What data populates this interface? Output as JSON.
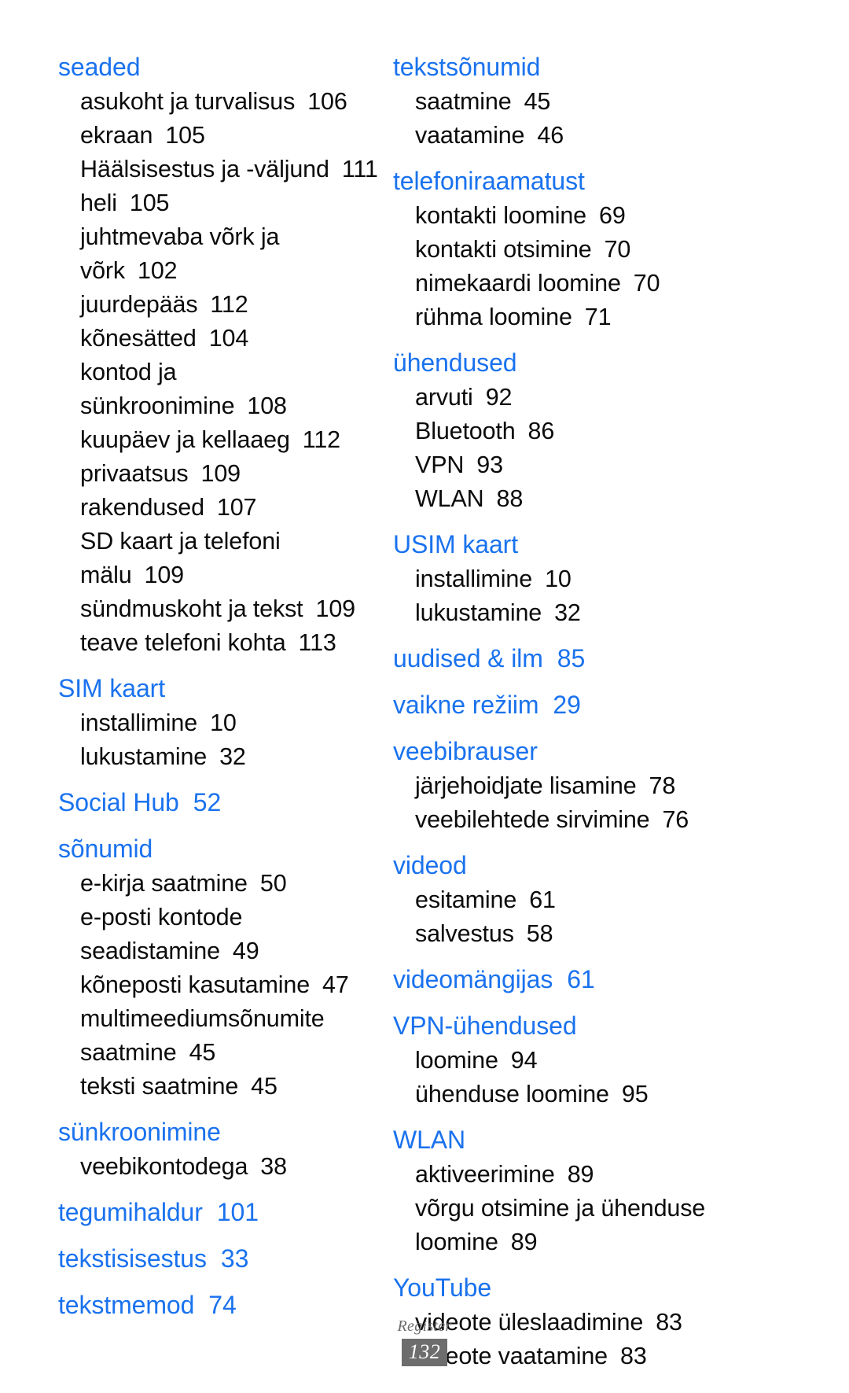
{
  "document": {
    "footer_label": "Register",
    "page_number": "132",
    "accent_color": "#1a72ee",
    "footer_color": "#6d6d6d"
  },
  "index": {
    "left_column": [
      {
        "heading": "seaded",
        "heading_page": "",
        "entries": [
          {
            "text": "asukoht ja turvalisus",
            "page": "106"
          },
          {
            "text": "ekraan",
            "page": "105"
          },
          {
            "text": "Häälsisestus ja -väljund",
            "page": "111"
          },
          {
            "text": "heli",
            "page": "105"
          },
          {
            "text": "juhtmevaba võrk ja",
            "page": ""
          },
          {
            "text": "võrk",
            "page": "102"
          },
          {
            "text": "juurdepääs",
            "page": "112"
          },
          {
            "text": "kõnesätted",
            "page": "104"
          },
          {
            "text": "kontod ja",
            "page": ""
          },
          {
            "text": "sünkroonimine",
            "page": "108"
          },
          {
            "text": "kuupäev ja kellaaeg",
            "page": "112"
          },
          {
            "text": "privaatsus",
            "page": "109"
          },
          {
            "text": "rakendused",
            "page": "107"
          },
          {
            "text": "SD kaart ja telefoni",
            "page": ""
          },
          {
            "text": "mälu",
            "page": "109"
          },
          {
            "text": "sündmuskoht ja tekst",
            "page": "109"
          },
          {
            "text": "teave telefoni kohta",
            "page": "113"
          }
        ]
      },
      {
        "heading": "SIM kaart",
        "heading_page": "",
        "entries": [
          {
            "text": "installimine",
            "page": "10"
          },
          {
            "text": "lukustamine",
            "page": "32"
          }
        ]
      },
      {
        "heading": "Social Hub",
        "heading_page": "52",
        "entries": []
      },
      {
        "heading": "sõnumid",
        "heading_page": "",
        "entries": [
          {
            "text": "e-kirja saatmine",
            "page": "50"
          },
          {
            "text": "e-posti kontode",
            "page": ""
          },
          {
            "text": "seadistamine",
            "page": "49"
          },
          {
            "text": "kõneposti kasutamine",
            "page": "47"
          },
          {
            "text": "multimeediumsõnumite",
            "page": ""
          },
          {
            "text": "saatmine",
            "page": "45"
          },
          {
            "text": "teksti saatmine",
            "page": "45"
          }
        ]
      },
      {
        "heading": "sünkroonimine",
        "heading_page": "",
        "entries": [
          {
            "text": "veebikontodega",
            "page": "38"
          }
        ]
      },
      {
        "heading": "tegumihaldur",
        "heading_page": "101",
        "entries": []
      },
      {
        "heading": "tekstisisestus",
        "heading_page": "33",
        "entries": []
      },
      {
        "heading": "tekstmemod",
        "heading_page": "74",
        "entries": []
      }
    ],
    "right_column": [
      {
        "heading": "tekstsõnumid",
        "heading_page": "",
        "entries": [
          {
            "text": "saatmine",
            "page": "45"
          },
          {
            "text": "vaatamine",
            "page": "46"
          }
        ]
      },
      {
        "heading": "telefoniraamatust",
        "heading_page": "",
        "entries": [
          {
            "text": "kontakti loomine",
            "page": "69"
          },
          {
            "text": "kontakti otsimine",
            "page": "70"
          },
          {
            "text": "nimekaardi loomine",
            "page": "70"
          },
          {
            "text": "rühma loomine",
            "page": "71"
          }
        ]
      },
      {
        "heading": "ühendused",
        "heading_page": "",
        "entries": [
          {
            "text": "arvuti",
            "page": "92"
          },
          {
            "text": "Bluetooth",
            "page": "86"
          },
          {
            "text": "VPN",
            "page": "93"
          },
          {
            "text": "WLAN",
            "page": "88"
          }
        ]
      },
      {
        "heading": "USIM kaart",
        "heading_page": "",
        "entries": [
          {
            "text": "installimine",
            "page": "10"
          },
          {
            "text": "lukustamine",
            "page": "32"
          }
        ]
      },
      {
        "heading": "uudised & ilm",
        "heading_page": "85",
        "entries": []
      },
      {
        "heading": "vaikne režiim",
        "heading_page": "29",
        "entries": []
      },
      {
        "heading": "veebibrauser",
        "heading_page": "",
        "entries": [
          {
            "text": "järjehoidjate lisamine",
            "page": "78"
          },
          {
            "text": "veebilehtede sirvimine",
            "page": "76"
          }
        ]
      },
      {
        "heading": "videod",
        "heading_page": "",
        "entries": [
          {
            "text": "esitamine",
            "page": "61"
          },
          {
            "text": "salvestus",
            "page": "58"
          }
        ]
      },
      {
        "heading": "videomängijas",
        "heading_page": "61",
        "entries": []
      },
      {
        "heading": "VPN-ühendused",
        "heading_page": "",
        "entries": [
          {
            "text": "loomine",
            "page": "94"
          },
          {
            "text": "ühenduse loomine",
            "page": "95"
          }
        ]
      },
      {
        "heading": "WLAN",
        "heading_page": "",
        "entries": [
          {
            "text": "aktiveerimine",
            "page": "89"
          },
          {
            "text": "võrgu otsimine ja ühenduse",
            "page": ""
          },
          {
            "text": "loomine",
            "page": "89"
          }
        ]
      },
      {
        "heading": "YouTube",
        "heading_page": "",
        "entries": [
          {
            "text": "videote üleslaadimine",
            "page": "83"
          },
          {
            "text": "videote vaatamine",
            "page": "83"
          }
        ]
      }
    ]
  }
}
